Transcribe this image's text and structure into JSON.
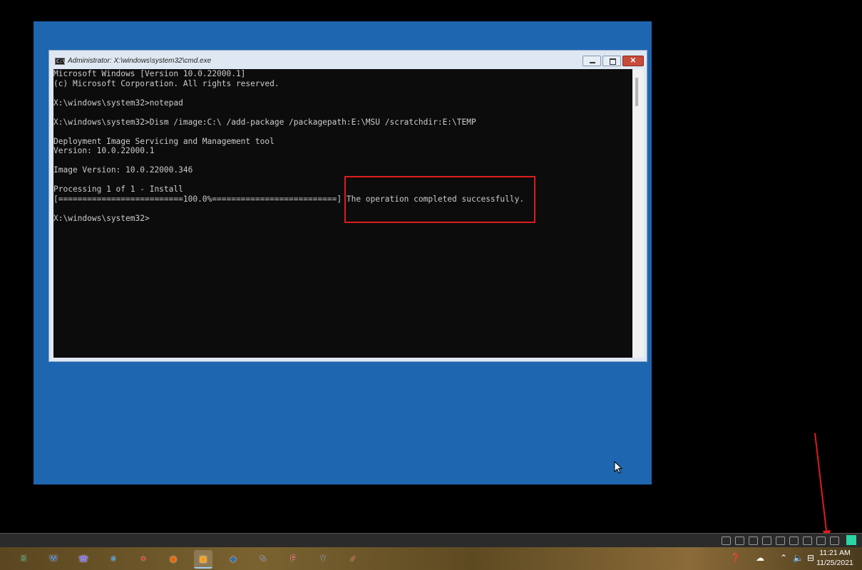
{
  "window": {
    "title": "Administrator: X:\\windows\\system32\\cmd.exe",
    "close_glyph": "✕"
  },
  "console": {
    "lines": [
      "Microsoft Windows [Version 10.0.22000.1]",
      "(c) Microsoft Corporation. All rights reserved.",
      "",
      "X:\\windows\\system32>notepad",
      "",
      "X:\\windows\\system32>Dism /image:C:\\ /add-package /packagepath:E:\\MSU /scratchdir:E:\\TEMP",
      "",
      "Deployment Image Servicing and Management tool",
      "Version: 10.0.22000.1",
      "",
      "Image Version: 10.0.22000.346",
      "",
      "Processing 1 of 1 - Install",
      "[==========================100.0%==========================] The operation completed successfully.",
      "",
      "X:\\windows\\system32>"
    ]
  },
  "taskbar": {
    "apps": [
      {
        "name": "excel-app-icon",
        "glyph": "X",
        "color": "#1d7a43"
      },
      {
        "name": "word-app-icon",
        "glyph": "W",
        "color": "#2b579a"
      },
      {
        "name": "viber-app-icon",
        "glyph": "☏",
        "color": "#7360f2"
      },
      {
        "name": "edge-app-icon",
        "glyph": "e",
        "color": "#1c8ad8"
      },
      {
        "name": "chrome-app-icon",
        "glyph": "●",
        "color": "#d93b2b"
      },
      {
        "name": "firefox-app-icon",
        "glyph": "◉",
        "color": "#e66000"
      },
      {
        "name": "vmware-app-icon",
        "glyph": "▣",
        "color": "#f39c12"
      },
      {
        "name": "virtualbox-app-icon",
        "glyph": "◆",
        "color": "#2f6fb0"
      },
      {
        "name": "tool-app-icon",
        "glyph": "✎",
        "color": "#606060"
      },
      {
        "name": "filezilla-app-icon",
        "glyph": "F",
        "color": "#b3232c"
      },
      {
        "name": "yandex-app-icon",
        "glyph": "Y",
        "color": "#444444"
      },
      {
        "name": "pdf-app-icon",
        "glyph": "✓",
        "color": "#c0392b"
      }
    ],
    "clock": {
      "time": "11:21 AM",
      "date": "11/25/2021"
    }
  }
}
